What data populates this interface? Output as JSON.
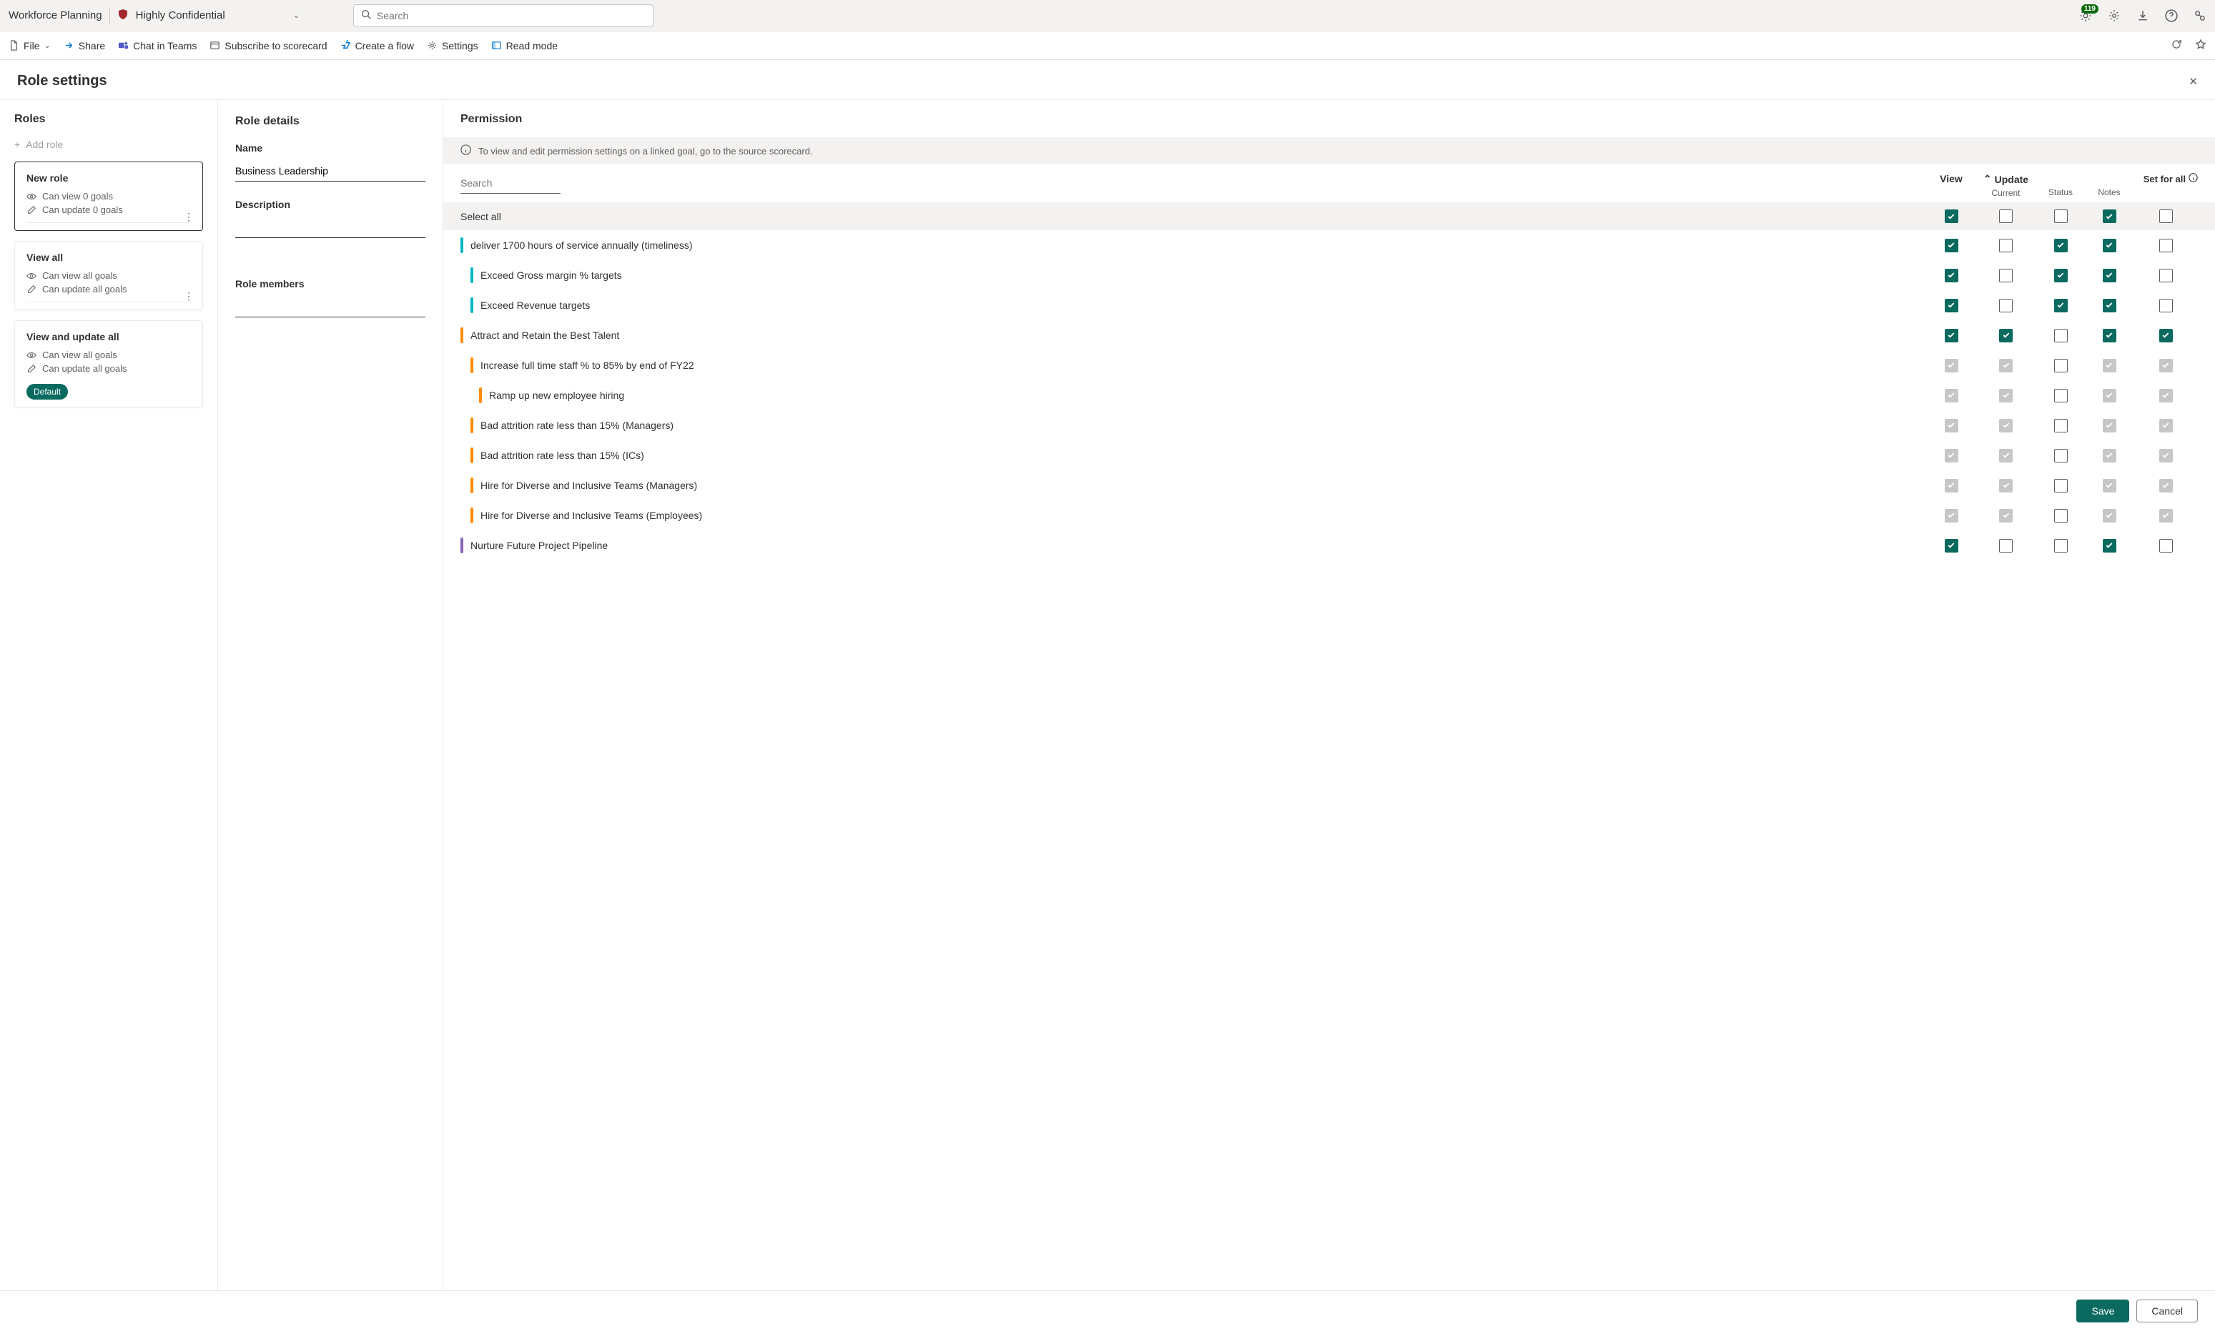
{
  "top": {
    "app_title": "Workforce Planning",
    "sensitivity": "Highly Confidential",
    "search_placeholder": "Search",
    "badge": "119"
  },
  "cmd": {
    "file": "File",
    "share": "Share",
    "chat": "Chat in Teams",
    "subscribe": "Subscribe to scorecard",
    "flow": "Create a flow",
    "settings": "Settings",
    "read": "Read mode"
  },
  "panel": {
    "title": "Role settings"
  },
  "roles": {
    "heading": "Roles",
    "add": "Add role",
    "cards": [
      {
        "title": "New role",
        "line1": "Can view 0 goals",
        "line2": "Can update 0 goals",
        "selected": true,
        "more": true
      },
      {
        "title": "View all",
        "line1": "Can view all goals",
        "line2": "Can update all goals",
        "selected": false,
        "more": true
      },
      {
        "title": "View and update all",
        "line1": "Can view all goals",
        "line2": "Can update all goals",
        "selected": false,
        "default": "Default"
      }
    ]
  },
  "details": {
    "heading": "Role details",
    "name_label": "Name",
    "name_value": "Business Leadership",
    "desc_label": "Description",
    "desc_value": "",
    "members_label": "Role members",
    "members_value": ""
  },
  "perm": {
    "heading": "Permission",
    "banner": "To view and edit permission settings on a linked goal, go to the source scorecard.",
    "search_placeholder": "Search",
    "cols": {
      "view": "View",
      "update": "Update",
      "current": "Current",
      "status": "Status",
      "notes": "Notes",
      "setfor": "Set for all"
    },
    "select_all": "Select all",
    "select_all_checks": {
      "view": "checked",
      "current": "",
      "status": "",
      "notes": "checked",
      "setfor": ""
    },
    "rows": [
      {
        "indent": 1,
        "bar": "cyan",
        "label": "deliver 1700 hours of service annually (timeliness)",
        "view": "checked",
        "current": "",
        "status": "checked",
        "notes": "checked",
        "setfor": ""
      },
      {
        "indent": 2,
        "bar": "cyan",
        "label": "Exceed Gross margin % targets",
        "view": "checked",
        "current": "",
        "status": "checked",
        "notes": "checked",
        "setfor": ""
      },
      {
        "indent": 2,
        "bar": "cyan",
        "label": "Exceed Revenue targets",
        "view": "checked",
        "current": "",
        "status": "checked",
        "notes": "checked",
        "setfor": ""
      },
      {
        "indent": 1,
        "bar": "orange",
        "label": "Attract and Retain the Best Talent",
        "view": "checked",
        "current": "checked",
        "status": "",
        "notes": "checked",
        "setfor": "checked"
      },
      {
        "indent": 2,
        "bar": "orange",
        "label": "Increase full time staff % to 85% by end of FY22",
        "view": "disabled",
        "current": "disabled",
        "status": "",
        "notes": "disabled",
        "setfor": "disabled"
      },
      {
        "indent": 3,
        "bar": "orange",
        "label": "Ramp up new employee hiring",
        "view": "disabled",
        "current": "disabled",
        "status": "",
        "notes": "disabled",
        "setfor": "disabled"
      },
      {
        "indent": 2,
        "bar": "orange",
        "label": "Bad attrition rate less than 15% (Managers)",
        "view": "disabled",
        "current": "disabled",
        "status": "",
        "notes": "disabled",
        "setfor": "disabled"
      },
      {
        "indent": 2,
        "bar": "orange",
        "label": "Bad attrition rate less than 15% (ICs)",
        "view": "disabled",
        "current": "disabled",
        "status": "",
        "notes": "disabled",
        "setfor": "disabled"
      },
      {
        "indent": 2,
        "bar": "orange",
        "label": "Hire for Diverse and Inclusive Teams (Managers)",
        "view": "disabled",
        "current": "disabled",
        "status": "",
        "notes": "disabled",
        "setfor": "disabled"
      },
      {
        "indent": 2,
        "bar": "orange",
        "label": "Hire for Diverse and Inclusive Teams (Employees)",
        "view": "disabled",
        "current": "disabled",
        "status": "",
        "notes": "disabled",
        "setfor": "disabled"
      },
      {
        "indent": 1,
        "bar": "purple",
        "label": "Nurture Future Project Pipeline",
        "view": "checked",
        "current": "",
        "status": "",
        "notes": "checked",
        "setfor": ""
      }
    ]
  },
  "footer": {
    "save": "Save",
    "cancel": "Cancel"
  }
}
